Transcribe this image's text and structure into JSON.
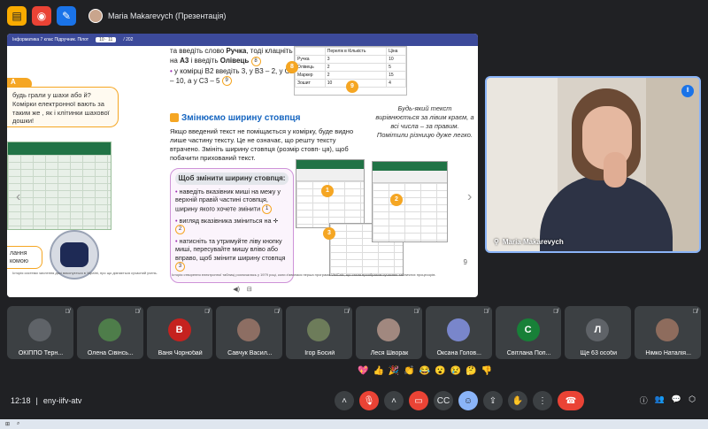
{
  "topbar": {
    "presenter": "Maria Makarevych (Презентація)"
  },
  "slide": {
    "pdf_title": "Інформатика 7 клас Підручник. Пілот",
    "pdf_page": "10 · 11",
    "pdf_total": "/ 202",
    "tag": "А",
    "bubble_left": "будь грали у шахи або й? Комірки електронної вають за таким же , як і клітинки шахової дошки!",
    "small_bubble": "лання комою",
    "mid_top_1": "та введіть слово ",
    "mid_top_word": "Ручка",
    "mid_top_2": ", тоді клацніть на ",
    "mid_top_cell": "А3",
    "mid_top_3": " і введіть ",
    "mid_top_word2": "Олівець",
    "mid_num8": "8",
    "mid_line2": "у комірці B2 введіть 3, у B3 – 2, у C2 – 10, а у C3 – 5",
    "mid_num9": "9",
    "section_title": "Змінюємо ширину стовпця",
    "section_para": "Якщо введений текст не поміщається у комірку, буде видно лише частину тексту. Це не означає, що решту тексту втрачено. Змініть ширину стовпця (розмір стовп- ця), щоб побачити прихований текст.",
    "box_title": "Щоб змінити ширину стовпця:",
    "box_item1": "наведіть вказівник миші на межу у верхній правій частині стовпця, ширину якого хочете змінити",
    "box_num1": "1",
    "box_item2": "вигляд вказівника зміниться на",
    "box_num2": "2",
    "box_item3": "натисніть та утримуйте ліву кнопку миші, пересувайте мишу вліво або вправо, щоб змінити ширину стовпця",
    "box_num3": "3",
    "italic_note": "Будь-який текст вирівнюється за лівим краєм, а всі числа – за правим. Помітили різницю дуже легко.",
    "table_header": [
      "",
      "Перелік в Кількість",
      "Ціна"
    ],
    "table_rows": [
      [
        "Ручка",
        "3",
        "10"
      ],
      [
        "Олівець",
        "2",
        "5"
      ],
      [
        "Маркер",
        "2",
        "15"
      ],
      [
        "Зошит",
        "10",
        "4"
      ]
    ],
    "dot8": "8",
    "dot9": "9",
    "dot1": "1",
    "dot2": "2",
    "dot3": "3",
    "footnote_left": "Історія системи числення досі виконується в Україні, про що дізнається сучасний учень.",
    "footnote_right": "Історія створення електронної таблиці розпочалась у 1979 році, коли з'явилася перша програма VisiCalc, що стала прообразом сучасних табличних процесорів.",
    "page_no": "9",
    "zoom_label": "⊟"
  },
  "speaker": {
    "name": "Maria Makarevych"
  },
  "participants": [
    {
      "name": "ОКІППО Терн...",
      "initial": "",
      "color": "#5f6368"
    },
    {
      "name": "Олена Сівінсь...",
      "initial": "",
      "color": "#4e7d4a"
    },
    {
      "name": "Ваня Чорнобай",
      "initial": "В",
      "color": "#c5221f"
    },
    {
      "name": "Савчук Васил...",
      "initial": "",
      "color": "#8d6e63"
    },
    {
      "name": "Ігор Босий",
      "initial": "",
      "color": "#6d7c5a"
    },
    {
      "name": "Леся Шворак",
      "initial": "",
      "color": "#a1887f"
    },
    {
      "name": "Оксана Голов...",
      "initial": "",
      "color": "#7986cb"
    },
    {
      "name": "Світлана Поп...",
      "initial": "С",
      "color": "#188038"
    },
    {
      "name": "Ще 63 особи",
      "initial": "Л",
      "color": "#5f6368"
    },
    {
      "name": "Німко Наталія...",
      "initial": "",
      "color": "#8e6c5d"
    }
  ],
  "bottombar": {
    "time": "12:18",
    "separator": "|",
    "code": "eny-iifv-atv"
  }
}
